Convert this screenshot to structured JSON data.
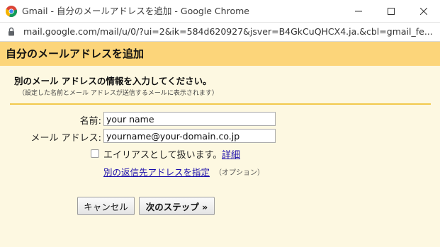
{
  "window": {
    "title": "Gmail - 自分のメールアドレスを追加 - Google Chrome",
    "app_icon": "chrome-icon",
    "controls": [
      "minimize-icon",
      "maximize-icon",
      "close-icon"
    ]
  },
  "address_bar": {
    "url": "mail.google.com/mail/u/0/?ui=2&ik=584d620927&jsver=B4GkCuQHCX4.ja.&cbl=gmail_fe...",
    "secure_icon": "lock-icon"
  },
  "dialog": {
    "title": "自分のメールアドレスを追加",
    "section_title": "別のメール アドレスの情報を入力してください。",
    "section_subtitle": "（設定した名前とメール アドレスが送信するメールに表示されます）",
    "name_label": "名前:",
    "name_value": "your name",
    "email_label": "メール アドレス:",
    "email_value": "yourname@your-domain.co.jp",
    "alias_checkbox_label": "エイリアスとして扱います。",
    "alias_checked": false,
    "details_link": "詳細",
    "replyto_link": "別の返信先アドレスを指定",
    "optional_note": "（オプション）",
    "cancel_button": "キャンセル",
    "next_button": "次のステップ »"
  },
  "colors": {
    "header_bg": "#fcd57a",
    "dialog_bg": "#fdf8e1",
    "divider": "#f2c94c",
    "link": "#1a0dab"
  }
}
